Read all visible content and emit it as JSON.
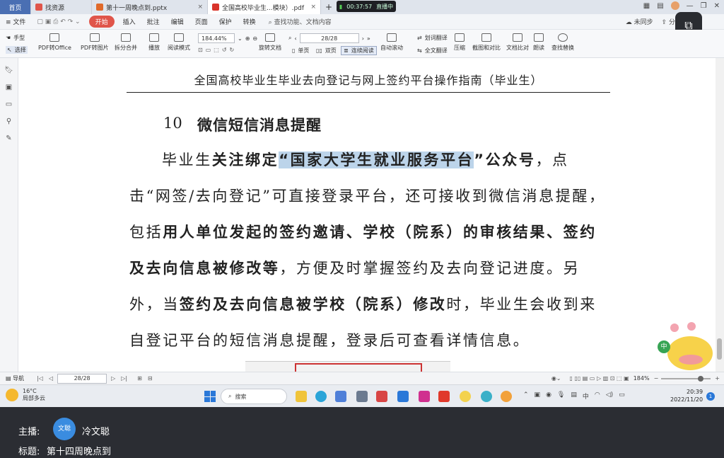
{
  "tabs": [
    {
      "label": "首页",
      "active": false
    },
    {
      "label": "找资源",
      "active": false
    },
    {
      "label": "第十一周晚点到.pptx",
      "active": false
    },
    {
      "label": "全国高校毕业生...模块）.pdf",
      "active": true
    }
  ],
  "live": {
    "time": "00:37:57",
    "status": "直播中"
  },
  "menu": {
    "file": "文件",
    "start": "开始",
    "items": [
      "插入",
      "批注",
      "编辑",
      "页面",
      "保护",
      "转换"
    ],
    "search": "查找功能、文档内容",
    "sync": "未同步",
    "share": "分享"
  },
  "toolbar": {
    "hand": "手型",
    "select": "选择",
    "pdf_to_office": "PDF转Office",
    "pdf_to_image": "PDF转图片",
    "split_merge": "拆分合并",
    "play": "播放",
    "read_mode": "阅读模式",
    "zoom": "184.44%",
    "page": "28/28",
    "rotate": "旋转文档",
    "single": "单页",
    "double": "双页",
    "continuous": "连续阅读",
    "auto_scroll": "自动滚动",
    "translate_word": "划词翻译",
    "translate_full": "全文翻译",
    "compress": "压缩",
    "screenshot": "截图和对比",
    "compare": "文档比对",
    "read_aloud": "朗读",
    "find_replace": "查找替换"
  },
  "document": {
    "header": "全国高校毕业生毕业去向登记与网上签约平台操作指南（毕业生）",
    "section_number": "10",
    "section_title": "微信短信消息提醒",
    "p1": "毕业生",
    "p2": "关注绑定",
    "p3": "“国家大学生就业服务平台",
    "p4": "”公众号",
    "p5": "，点击“网签/去向登记”可直接登录平台，还可接收到微信消息提醒，包括",
    "p6": "用人单位发起的签约邀请、学校（院系）的审核结果、签约及去向信息被修改等",
    "p7": "，方便及时掌握签约及去向登记进度。另外，当",
    "p8": "签约及去向信息被学校（院系）修改",
    "p9": "时，毕业生会收到来自登记平台的短信消息提醒，登录后可查看详情信息。"
  },
  "statusbar": {
    "nav": "导航",
    "page": "28/28",
    "zoom": "184%"
  },
  "taskbar": {
    "temp": "16°C",
    "weather": "局部多云",
    "search": "搜索",
    "time": "20:39",
    "date": "2022/11/20",
    "notifications": "1"
  },
  "stream": {
    "host_label": "主播:",
    "host_avatar": "文聪",
    "host_name": "冷文聪",
    "topic_label": "标题:",
    "topic": "第十四周晚点到"
  },
  "mascot": {
    "badge": "中"
  },
  "colors": {
    "accent": "#e0554a",
    "highlight": "#bcd4ea",
    "taskbar_blue": "#2a78d8"
  }
}
